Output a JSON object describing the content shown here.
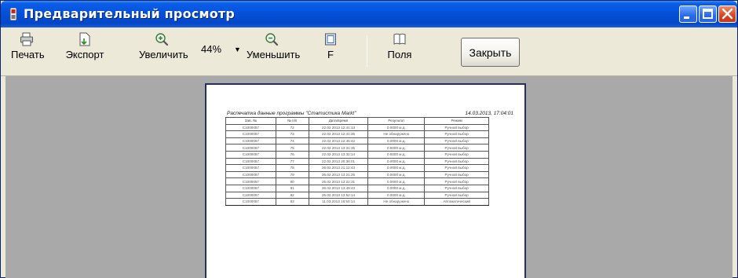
{
  "window": {
    "title": "Предварительный просмотр",
    "colors": {
      "titlebar": "#0350d8",
      "toolbar": "#ece9d8",
      "preview_bg": "#a9a9a9"
    }
  },
  "toolbar": {
    "print_label": "Печать",
    "export_label": "Экспорт",
    "zoom_in_label": "Увеличить",
    "zoom_value": "44%",
    "zoom_out_label": "Уменьшить",
    "fit_label": "F",
    "fields_label": "Поля",
    "close_label": "Закрыть",
    "icons": [
      "printer-icon",
      "export-icon",
      "zoom-in-icon",
      "zoom-out-icon",
      "fit-page-icon",
      "book-icon"
    ]
  },
  "report": {
    "title": "Распечатка данные программы \"Статистика Markt\"",
    "date": "14.03.2013, 17:04:01",
    "columns": [
      "Зав. №",
      "№ п/п",
      "Дата/время",
      "Результат",
      "Режим"
    ],
    "rows": [
      [
        "C1000057",
        "72",
        "22.02.2013 12:41:13",
        "0.0000 м.д.",
        "Ручной выбор"
      ],
      [
        "C1000057",
        "73",
        "22.02.2013 12:41:35",
        "Не обнаружено",
        "Ручной выбор"
      ],
      [
        "C1000057",
        "74",
        "22.02.2013 12:45:42",
        "0.0000 м.д.",
        "Ручной выбор"
      ],
      [
        "C1000057",
        "75",
        "22.02.2013 13:31:35",
        "0.0000 м.д.",
        "Ручной выбор"
      ],
      [
        "C1000057",
        "76",
        "22.02.2013 13:32:14",
        "0.0000 м.д.",
        "Ручной выбор"
      ],
      [
        "C1000057",
        "77",
        "22.02.2013 20:36:01",
        "0.0000 м.д.",
        "Ручной выбор"
      ],
      [
        "C1000057",
        "78",
        "26.02.2013 21:12:43",
        "0.0000 м.д.",
        "Ручной выбор"
      ],
      [
        "C1000057",
        "79",
        "26.02.2013 13:21:25",
        "0.0000 м.д.",
        "Ручной выбор"
      ],
      [
        "C1000057",
        "80",
        "26.02.2013 13:22:31",
        "0.0000 м.д.",
        "Ручной выбор"
      ],
      [
        "C1000057",
        "81",
        "26.02.2013 13:49:43",
        "0.0000 м.д.",
        "Ручной выбор"
      ],
      [
        "C1000057",
        "82",
        "26.02.2013 13:52:14",
        "0.0000 м.д.",
        "Ручной выбор"
      ],
      [
        "C1000057",
        "83",
        "11.03.2013 16:50:14",
        "Не обнаружено",
        "Автоматический"
      ]
    ]
  }
}
